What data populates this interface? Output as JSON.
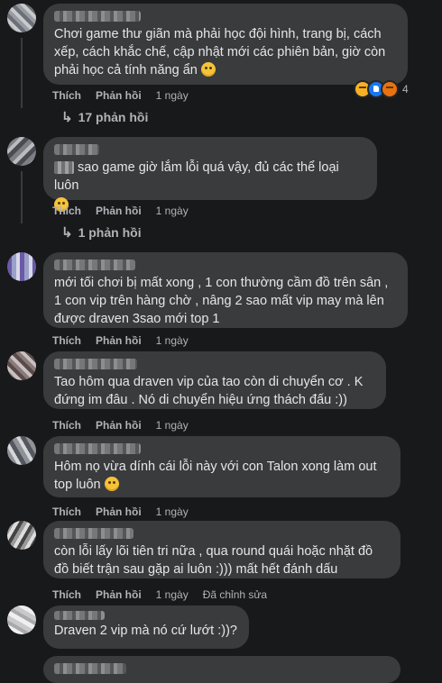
{
  "labels": {
    "like": "Thích",
    "reply": "Phản hồi"
  },
  "comments": [
    {
      "text": "Chơi game thư giãn mà phải học đội hình, trang bị, cách xếp, cách khắc chế, cập nhật mới các phiên bản, giờ còn phải học cả tính năng ẩn",
      "emoji": "astonished-emoji",
      "time": "1 ngày",
      "reactions": {
        "icons": [
          "wow",
          "like",
          "angry"
        ],
        "count": "4"
      },
      "replies": "17 phản hồi"
    },
    {
      "text": "sao game giờ lắm lỗi quá vậy, đủ các thể loại luôn",
      "emoji": "face-emoji",
      "time": "1 ngày",
      "replies": "1 phản hồi"
    },
    {
      "text": "mới tối chơi bị mất xong , 1 con thường cầm đồ trên sân , 1 con vip trên hàng chờ , nâng 2 sao mất vip may mà lên được draven 3sao mới top 1",
      "time": "1 ngày"
    },
    {
      "text": "Tao hôm qua draven vip của tao còn di chuyển cơ . K đứng im đâu . Nó di chuyển hiệu ứng thách đấu :))",
      "time": "1 ngày"
    },
    {
      "text": "Hôm nọ vừa dính cái lỗi này với con Talon xong làm out top luôn",
      "emoji": "hushed-emoji",
      "time": "1 ngày"
    },
    {
      "text": "còn lỗi lấy lõi tiên tri nữa , qua round quái hoặc nhặt đồ đồ biết trận sau gặp ai luôn :))) mất hết đánh dấu",
      "time": "1 ngày",
      "edited": "Đã chỉnh sửa"
    },
    {
      "text": "Draven 2 vip mà nó cứ lướt :))?"
    }
  ]
}
